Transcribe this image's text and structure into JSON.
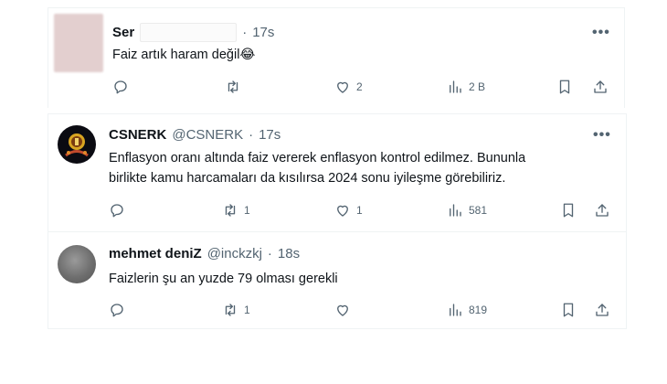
{
  "tweets": [
    {
      "name": "Ser",
      "handle": "",
      "dot": "·",
      "time": "17s",
      "text": "Faiz artık haram değil",
      "emoji": "😂",
      "replies": "",
      "retweets": "",
      "likes": "2",
      "views": "2 B"
    },
    {
      "name": "CSNERK",
      "handle": "@CSNERK",
      "dot": "·",
      "time": "17s",
      "text_line1": "Enflasyon oranı altında faiz vererek enflasyon kontrol edilmez. Bununla",
      "text_line2": "birlikte kamu harcamaları da kısılırsa 2024 sonu iyileşme görebiliriz.",
      "replies": "",
      "retweets": "1",
      "likes": "1",
      "views": "581"
    },
    {
      "name": "mehmet deniZ",
      "handle": "@inckzkj",
      "dot": "·",
      "time": "18s",
      "text": "Faizlerin şu an yuzde 79 olması gerekli",
      "replies": "",
      "retweets": "1",
      "likes": "",
      "views": "819"
    }
  ],
  "more_glyph": "•••",
  "colors": {
    "icon": "#536471",
    "text": "#0f1419",
    "divider": "#eff3f4"
  },
  "icons": [
    "reply-icon",
    "retweet-icon",
    "like-icon",
    "views-icon",
    "bookmark-icon",
    "share-icon"
  ]
}
